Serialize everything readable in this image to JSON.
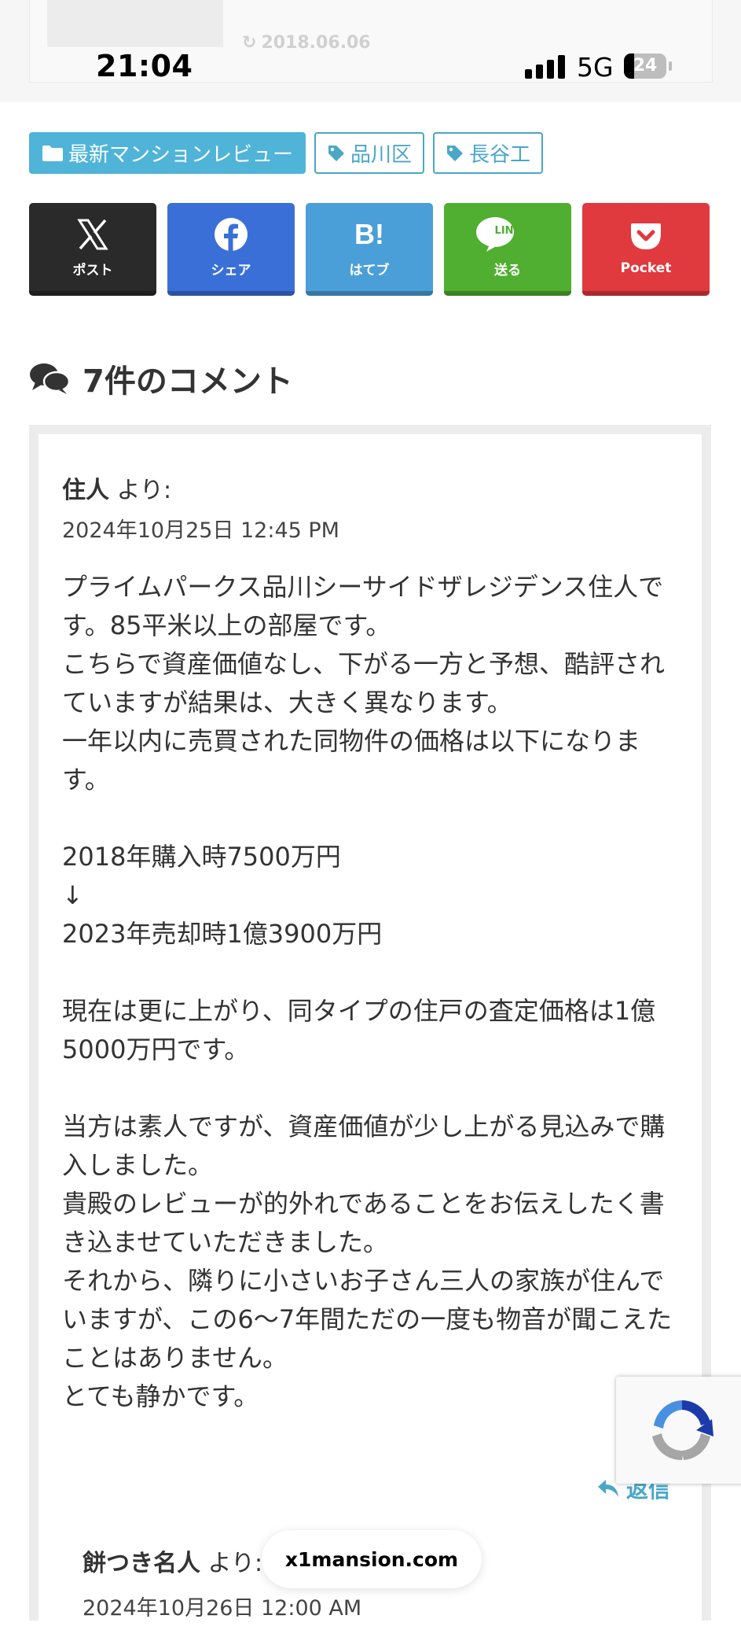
{
  "status_bar": {
    "time": "21:04",
    "network": "5G",
    "battery_percent": "24",
    "battery_level": 0.24
  },
  "prev_article": {
    "date": "2018.06.06"
  },
  "tags": [
    {
      "label": "最新マンションレビュー",
      "kind": "category"
    },
    {
      "label": "品川区",
      "kind": "tag"
    },
    {
      "label": "長谷工",
      "kind": "tag"
    }
  ],
  "share": {
    "x_label": "ポスト",
    "facebook_label": "シェア",
    "hatena_label": "はてブ",
    "hatena_icon_text": "B!",
    "line_label": "送る",
    "line_icon_text": "LINE",
    "pocket_label": "Pocket",
    "colors": {
      "x": "#2a2a2a",
      "facebook": "#3b6fd8",
      "hatena": "#4b9fd9",
      "line": "#50ae31",
      "pocket": "#e0393e"
    }
  },
  "comments": {
    "heading": "7件のコメント",
    "items": [
      {
        "author": "住人",
        "suffix": "より:",
        "date": "2024年10月25日 12:45 PM",
        "lines": [
          "プライムパークス品川シーサイドザレジデンス住人です。85平米以上の部屋です。",
          "こちらで資産価値なし、下がる一方と予想、酷評されていますが結果は、大きく異なります。",
          "一年以内に売買された同物件の価格は以下になります。",
          "",
          "2018年購入時7500万円",
          "↓",
          "2023年売却時1億3900万円",
          "",
          "現在は更に上がり、同タイプの住戸の査定価格は1億5000万円です。",
          "",
          "当方は素人ですが、資産価値が少し上がる見込みで購入しました。",
          "貴殿のレビューが的外れであることをお伝えしたく書き込ませていただきました。",
          "それから、隣りに小さいお子さん三人の家族が住んでいますが、この6〜7年間ただの一度も物音が聞こえたことはありません。",
          "とても静かです。"
        ],
        "reply_label": "返信"
      },
      {
        "author": "餅つき名人",
        "suffix": "より:",
        "date": "2024年10月26日 12:00 AM"
      }
    ]
  },
  "browser": {
    "url": "x1mansion.com"
  },
  "accent_color": "#4aa7c8"
}
